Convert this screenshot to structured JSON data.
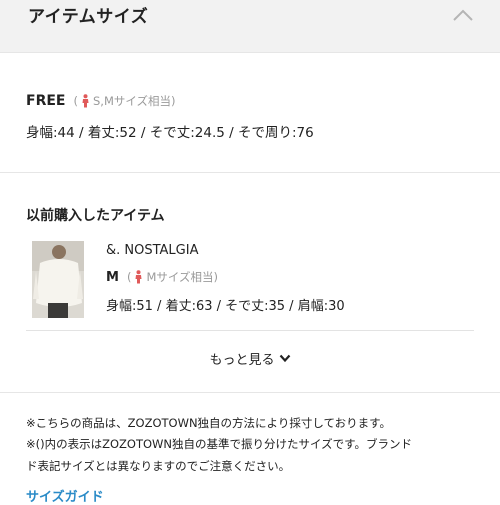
{
  "header": {
    "title": "アイテムサイズ"
  },
  "item_size": {
    "size_name": "FREE",
    "hint_open": "(",
    "hint_text": "S,Mサイズ相当)",
    "measurements": "身幅:44 / 着丈:52 / そで丈:24.5 / そで周り:76"
  },
  "purchased": {
    "title": "以前購入したアイテム",
    "item": {
      "brand": "&. NOSTALGIA",
      "size_name": "M",
      "hint_open": "(",
      "hint_text": "Mサイズ相当)",
      "measurements": "身幅:51 / 着丈:63 / そで丈:35 / 肩幅:30"
    },
    "more_label": "もっと見る"
  },
  "notes": {
    "line1": "※こちらの商品は、ZOZOTOWN独自の方法により採寸しております。",
    "line2": "※()内の表示はZOZOTOWN独自の基準で振り分けたサイズです。ブランド",
    "line3": "ド表記サイズとは異なりますのでご注意ください。",
    "size_guide_link": "サイズガイド"
  },
  "colors": {
    "accent_link": "#2a8bc7",
    "hint_icon": "#e05a5a",
    "header_bg": "#f2f2f2"
  }
}
